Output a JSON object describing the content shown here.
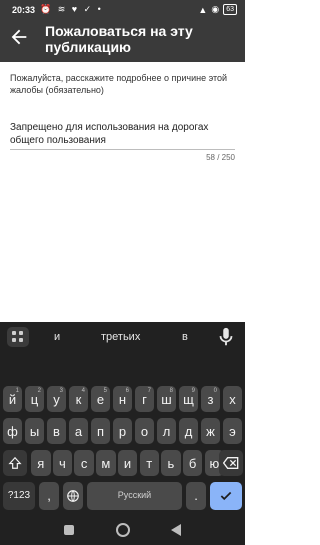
{
  "status_bar": {
    "time": "20:33",
    "left_icons": "⏰ ≋ ♥ ✓ •",
    "signal": "▲",
    "wifi": "◉",
    "battery": "63"
  },
  "app_bar": {
    "title": "Пожаловаться на эту публикацию"
  },
  "form": {
    "prompt": "Пожалуйста, расскажите подробнее о причине этой жалобы (обязательно)",
    "value": "Запрещено для использования на дорогах общего пользования",
    "counter": "58 / 250"
  },
  "keyboard": {
    "suggestions": [
      "и",
      "третьих",
      "в"
    ],
    "row1": [
      {
        "key": "й",
        "hint": "1"
      },
      {
        "key": "ц",
        "hint": "2"
      },
      {
        "key": "у",
        "hint": "3"
      },
      {
        "key": "к",
        "hint": "4"
      },
      {
        "key": "е",
        "hint": "5"
      },
      {
        "key": "н",
        "hint": "6"
      },
      {
        "key": "г",
        "hint": "7"
      },
      {
        "key": "ш",
        "hint": "8"
      },
      {
        "key": "щ",
        "hint": "9"
      },
      {
        "key": "з",
        "hint": "0"
      },
      {
        "key": "х",
        "hint": ""
      }
    ],
    "row2": [
      {
        "key": "ф",
        "hint": ""
      },
      {
        "key": "ы",
        "hint": ""
      },
      {
        "key": "в",
        "hint": ""
      },
      {
        "key": "а",
        "hint": ""
      },
      {
        "key": "п",
        "hint": ""
      },
      {
        "key": "р",
        "hint": ""
      },
      {
        "key": "о",
        "hint": ""
      },
      {
        "key": "л",
        "hint": ""
      },
      {
        "key": "д",
        "hint": ""
      },
      {
        "key": "ж",
        "hint": ""
      },
      {
        "key": "э",
        "hint": ""
      }
    ],
    "row3": [
      {
        "key": "я",
        "hint": ""
      },
      {
        "key": "ч",
        "hint": ""
      },
      {
        "key": "с",
        "hint": ""
      },
      {
        "key": "м",
        "hint": ""
      },
      {
        "key": "и",
        "hint": ""
      },
      {
        "key": "т",
        "hint": ""
      },
      {
        "key": "ь",
        "hint": ""
      },
      {
        "key": "б",
        "hint": ""
      },
      {
        "key": "ю",
        "hint": ""
      }
    ],
    "shift_icon": "shift-icon",
    "backspace_icon": "backspace-icon",
    "symbols_label": "?123",
    "comma_label": ",",
    "space_label": "Русский",
    "period_label": ".",
    "enter_icon": "checkmark-icon",
    "accent_color": "#8ab4f8"
  },
  "nav": {
    "recents_icon": "square-icon",
    "home_icon": "circle-icon",
    "back_icon": "triangle-icon"
  }
}
